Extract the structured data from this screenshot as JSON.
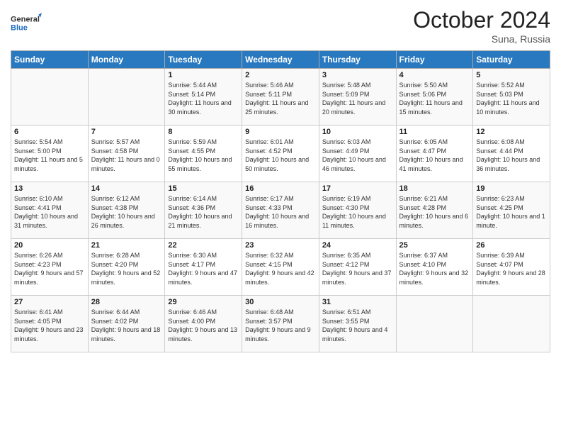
{
  "logo": {
    "line1": "General",
    "line2": "Blue"
  },
  "title": "October 2024",
  "location": "Suna, Russia",
  "days_of_week": [
    "Sunday",
    "Monday",
    "Tuesday",
    "Wednesday",
    "Thursday",
    "Friday",
    "Saturday"
  ],
  "weeks": [
    [
      {
        "day": "",
        "sunrise": "",
        "sunset": "",
        "daylight": ""
      },
      {
        "day": "",
        "sunrise": "",
        "sunset": "",
        "daylight": ""
      },
      {
        "day": "1",
        "sunrise": "Sunrise: 5:44 AM",
        "sunset": "Sunset: 5:14 PM",
        "daylight": "Daylight: 11 hours and 30 minutes."
      },
      {
        "day": "2",
        "sunrise": "Sunrise: 5:46 AM",
        "sunset": "Sunset: 5:11 PM",
        "daylight": "Daylight: 11 hours and 25 minutes."
      },
      {
        "day": "3",
        "sunrise": "Sunrise: 5:48 AM",
        "sunset": "Sunset: 5:09 PM",
        "daylight": "Daylight: 11 hours and 20 minutes."
      },
      {
        "day": "4",
        "sunrise": "Sunrise: 5:50 AM",
        "sunset": "Sunset: 5:06 PM",
        "daylight": "Daylight: 11 hours and 15 minutes."
      },
      {
        "day": "5",
        "sunrise": "Sunrise: 5:52 AM",
        "sunset": "Sunset: 5:03 PM",
        "daylight": "Daylight: 11 hours and 10 minutes."
      }
    ],
    [
      {
        "day": "6",
        "sunrise": "Sunrise: 5:54 AM",
        "sunset": "Sunset: 5:00 PM",
        "daylight": "Daylight: 11 hours and 5 minutes."
      },
      {
        "day": "7",
        "sunrise": "Sunrise: 5:57 AM",
        "sunset": "Sunset: 4:58 PM",
        "daylight": "Daylight: 11 hours and 0 minutes."
      },
      {
        "day": "8",
        "sunrise": "Sunrise: 5:59 AM",
        "sunset": "Sunset: 4:55 PM",
        "daylight": "Daylight: 10 hours and 55 minutes."
      },
      {
        "day": "9",
        "sunrise": "Sunrise: 6:01 AM",
        "sunset": "Sunset: 4:52 PM",
        "daylight": "Daylight: 10 hours and 50 minutes."
      },
      {
        "day": "10",
        "sunrise": "Sunrise: 6:03 AM",
        "sunset": "Sunset: 4:49 PM",
        "daylight": "Daylight: 10 hours and 46 minutes."
      },
      {
        "day": "11",
        "sunrise": "Sunrise: 6:05 AM",
        "sunset": "Sunset: 4:47 PM",
        "daylight": "Daylight: 10 hours and 41 minutes."
      },
      {
        "day": "12",
        "sunrise": "Sunrise: 6:08 AM",
        "sunset": "Sunset: 4:44 PM",
        "daylight": "Daylight: 10 hours and 36 minutes."
      }
    ],
    [
      {
        "day": "13",
        "sunrise": "Sunrise: 6:10 AM",
        "sunset": "Sunset: 4:41 PM",
        "daylight": "Daylight: 10 hours and 31 minutes."
      },
      {
        "day": "14",
        "sunrise": "Sunrise: 6:12 AM",
        "sunset": "Sunset: 4:38 PM",
        "daylight": "Daylight: 10 hours and 26 minutes."
      },
      {
        "day": "15",
        "sunrise": "Sunrise: 6:14 AM",
        "sunset": "Sunset: 4:36 PM",
        "daylight": "Daylight: 10 hours and 21 minutes."
      },
      {
        "day": "16",
        "sunrise": "Sunrise: 6:17 AM",
        "sunset": "Sunset: 4:33 PM",
        "daylight": "Daylight: 10 hours and 16 minutes."
      },
      {
        "day": "17",
        "sunrise": "Sunrise: 6:19 AM",
        "sunset": "Sunset: 4:30 PM",
        "daylight": "Daylight: 10 hours and 11 minutes."
      },
      {
        "day": "18",
        "sunrise": "Sunrise: 6:21 AM",
        "sunset": "Sunset: 4:28 PM",
        "daylight": "Daylight: 10 hours and 6 minutes."
      },
      {
        "day": "19",
        "sunrise": "Sunrise: 6:23 AM",
        "sunset": "Sunset: 4:25 PM",
        "daylight": "Daylight: 10 hours and 1 minute."
      }
    ],
    [
      {
        "day": "20",
        "sunrise": "Sunrise: 6:26 AM",
        "sunset": "Sunset: 4:23 PM",
        "daylight": "Daylight: 9 hours and 57 minutes."
      },
      {
        "day": "21",
        "sunrise": "Sunrise: 6:28 AM",
        "sunset": "Sunset: 4:20 PM",
        "daylight": "Daylight: 9 hours and 52 minutes."
      },
      {
        "day": "22",
        "sunrise": "Sunrise: 6:30 AM",
        "sunset": "Sunset: 4:17 PM",
        "daylight": "Daylight: 9 hours and 47 minutes."
      },
      {
        "day": "23",
        "sunrise": "Sunrise: 6:32 AM",
        "sunset": "Sunset: 4:15 PM",
        "daylight": "Daylight: 9 hours and 42 minutes."
      },
      {
        "day": "24",
        "sunrise": "Sunrise: 6:35 AM",
        "sunset": "Sunset: 4:12 PM",
        "daylight": "Daylight: 9 hours and 37 minutes."
      },
      {
        "day": "25",
        "sunrise": "Sunrise: 6:37 AM",
        "sunset": "Sunset: 4:10 PM",
        "daylight": "Daylight: 9 hours and 32 minutes."
      },
      {
        "day": "26",
        "sunrise": "Sunrise: 6:39 AM",
        "sunset": "Sunset: 4:07 PM",
        "daylight": "Daylight: 9 hours and 28 minutes."
      }
    ],
    [
      {
        "day": "27",
        "sunrise": "Sunrise: 6:41 AM",
        "sunset": "Sunset: 4:05 PM",
        "daylight": "Daylight: 9 hours and 23 minutes."
      },
      {
        "day": "28",
        "sunrise": "Sunrise: 6:44 AM",
        "sunset": "Sunset: 4:02 PM",
        "daylight": "Daylight: 9 hours and 18 minutes."
      },
      {
        "day": "29",
        "sunrise": "Sunrise: 6:46 AM",
        "sunset": "Sunset: 4:00 PM",
        "daylight": "Daylight: 9 hours and 13 minutes."
      },
      {
        "day": "30",
        "sunrise": "Sunrise: 6:48 AM",
        "sunset": "Sunset: 3:57 PM",
        "daylight": "Daylight: 9 hours and 9 minutes."
      },
      {
        "day": "31",
        "sunrise": "Sunrise: 6:51 AM",
        "sunset": "Sunset: 3:55 PM",
        "daylight": "Daylight: 9 hours and 4 minutes."
      },
      {
        "day": "",
        "sunrise": "",
        "sunset": "",
        "daylight": ""
      },
      {
        "day": "",
        "sunrise": "",
        "sunset": "",
        "daylight": ""
      }
    ]
  ]
}
